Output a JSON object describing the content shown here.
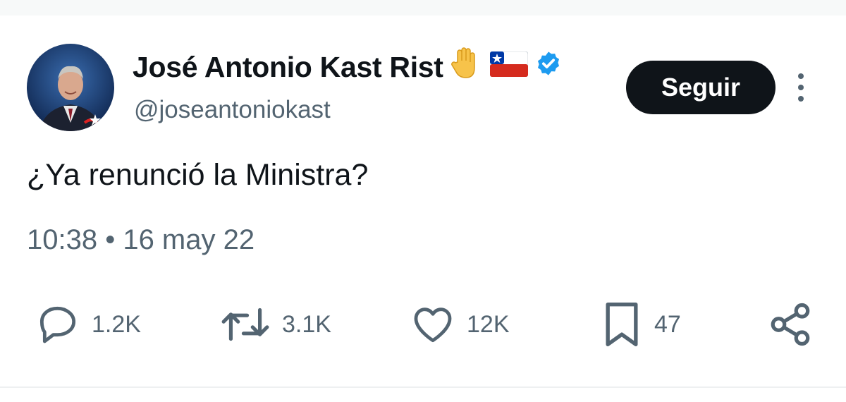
{
  "tweet": {
    "author": {
      "display_name": "José Antonio Kast Rist",
      "handle": "@joseantoniokast",
      "verified": true,
      "name_emojis": [
        "raised-hand",
        "flag-chile"
      ]
    },
    "follow_label": "Seguir",
    "text": "¿Ya renunció la Ministra?",
    "timestamp": "10:38 • 16 may 22",
    "actions": {
      "replies": "1.2K",
      "retweets": "3.1K",
      "likes": "12K",
      "bookmarks": "47"
    },
    "icons": [
      "reply-icon",
      "retweet-icon",
      "like-icon",
      "bookmark-icon",
      "share-icon",
      "more-icon",
      "verified-badge-icon"
    ]
  },
  "colors": {
    "text": "#0f1419",
    "secondary": "#536471",
    "verified": "#1d9bf0",
    "follow_bg": "#0f1419"
  }
}
